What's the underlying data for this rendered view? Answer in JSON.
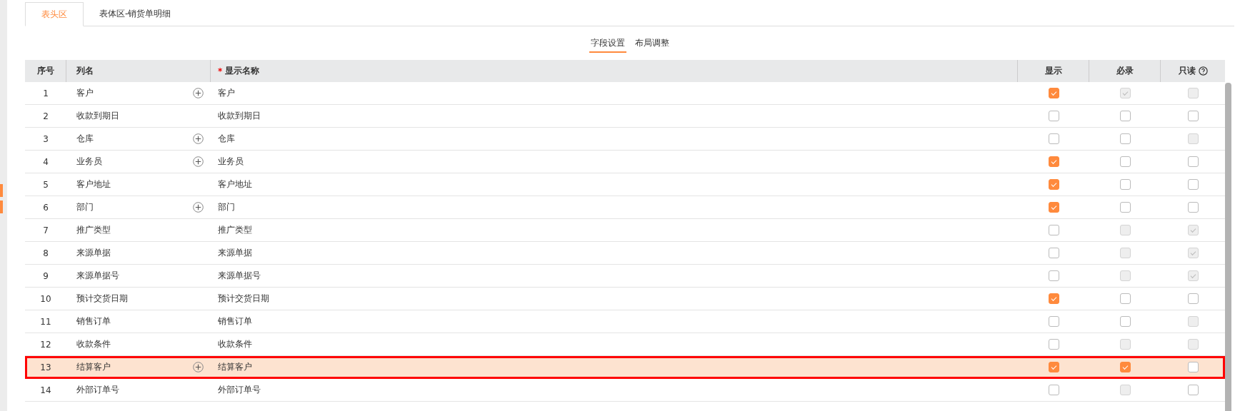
{
  "tabs": [
    {
      "label": "表头区",
      "selected": true
    },
    {
      "label": "表体区-销货单明细",
      "selected": false
    }
  ],
  "subtabs": [
    {
      "label": "字段设置",
      "selected": true
    },
    {
      "label": "布局调整",
      "selected": false
    }
  ],
  "columns": [
    "序号",
    "列名",
    "显示名称",
    "显示",
    "必录",
    "只读"
  ],
  "required_mark": "*",
  "rows": [
    {
      "no": "1",
      "column": "客户",
      "display": "客户",
      "has_add": true,
      "selected": false,
      "show": {
        "checked": true,
        "disabled": false
      },
      "required": {
        "checked": true,
        "disabled": true
      },
      "readonly": {
        "checked": false,
        "disabled": true
      }
    },
    {
      "no": "2",
      "column": "收款到期日",
      "display": "收款到期日",
      "has_add": false,
      "selected": false,
      "show": {
        "checked": false,
        "disabled": false
      },
      "required": {
        "checked": false,
        "disabled": false
      },
      "readonly": {
        "checked": false,
        "disabled": false
      }
    },
    {
      "no": "3",
      "column": "仓库",
      "display": "仓库",
      "has_add": true,
      "selected": false,
      "show": {
        "checked": false,
        "disabled": false
      },
      "required": {
        "checked": false,
        "disabled": false
      },
      "readonly": {
        "checked": false,
        "disabled": true
      }
    },
    {
      "no": "4",
      "column": "业务员",
      "display": "业务员",
      "has_add": true,
      "selected": false,
      "show": {
        "checked": true,
        "disabled": false
      },
      "required": {
        "checked": false,
        "disabled": false
      },
      "readonly": {
        "checked": false,
        "disabled": false
      }
    },
    {
      "no": "5",
      "column": "客户地址",
      "display": "客户地址",
      "has_add": false,
      "selected": false,
      "show": {
        "checked": true,
        "disabled": false
      },
      "required": {
        "checked": false,
        "disabled": false
      },
      "readonly": {
        "checked": false,
        "disabled": false
      }
    },
    {
      "no": "6",
      "column": "部门",
      "display": "部门",
      "has_add": true,
      "selected": false,
      "show": {
        "checked": true,
        "disabled": false
      },
      "required": {
        "checked": false,
        "disabled": false
      },
      "readonly": {
        "checked": false,
        "disabled": false
      }
    },
    {
      "no": "7",
      "column": "推广类型",
      "display": "推广类型",
      "has_add": false,
      "selected": false,
      "show": {
        "checked": false,
        "disabled": false
      },
      "required": {
        "checked": false,
        "disabled": true
      },
      "readonly": {
        "checked": true,
        "disabled": true
      }
    },
    {
      "no": "8",
      "column": "来源单据",
      "display": "来源单据",
      "has_add": false,
      "selected": false,
      "show": {
        "checked": false,
        "disabled": false
      },
      "required": {
        "checked": false,
        "disabled": true
      },
      "readonly": {
        "checked": true,
        "disabled": true
      }
    },
    {
      "no": "9",
      "column": "来源单据号",
      "display": "来源单据号",
      "has_add": false,
      "selected": false,
      "show": {
        "checked": false,
        "disabled": false
      },
      "required": {
        "checked": false,
        "disabled": true
      },
      "readonly": {
        "checked": true,
        "disabled": true
      }
    },
    {
      "no": "10",
      "column": "预计交货日期",
      "display": "预计交货日期",
      "has_add": false,
      "selected": false,
      "show": {
        "checked": true,
        "disabled": false
      },
      "required": {
        "checked": false,
        "disabled": false
      },
      "readonly": {
        "checked": false,
        "disabled": false
      }
    },
    {
      "no": "11",
      "column": "销售订单",
      "display": "销售订单",
      "has_add": false,
      "selected": false,
      "show": {
        "checked": false,
        "disabled": false
      },
      "required": {
        "checked": false,
        "disabled": false
      },
      "readonly": {
        "checked": false,
        "disabled": true
      }
    },
    {
      "no": "12",
      "column": "收款条件",
      "display": "收款条件",
      "has_add": false,
      "selected": false,
      "show": {
        "checked": false,
        "disabled": false
      },
      "required": {
        "checked": false,
        "disabled": true
      },
      "readonly": {
        "checked": false,
        "disabled": true
      }
    },
    {
      "no": "13",
      "column": "结算客户",
      "display": "结算客户",
      "has_add": true,
      "selected": true,
      "show": {
        "checked": true,
        "disabled": false
      },
      "required": {
        "checked": true,
        "disabled": false
      },
      "readonly": {
        "checked": false,
        "disabled": false
      }
    },
    {
      "no": "14",
      "column": "外部订单号",
      "display": "外部订单号",
      "has_add": false,
      "selected": false,
      "show": {
        "checked": false,
        "disabled": false
      },
      "required": {
        "checked": false,
        "disabled": true
      },
      "readonly": {
        "checked": false,
        "disabled": false
      }
    }
  ]
}
